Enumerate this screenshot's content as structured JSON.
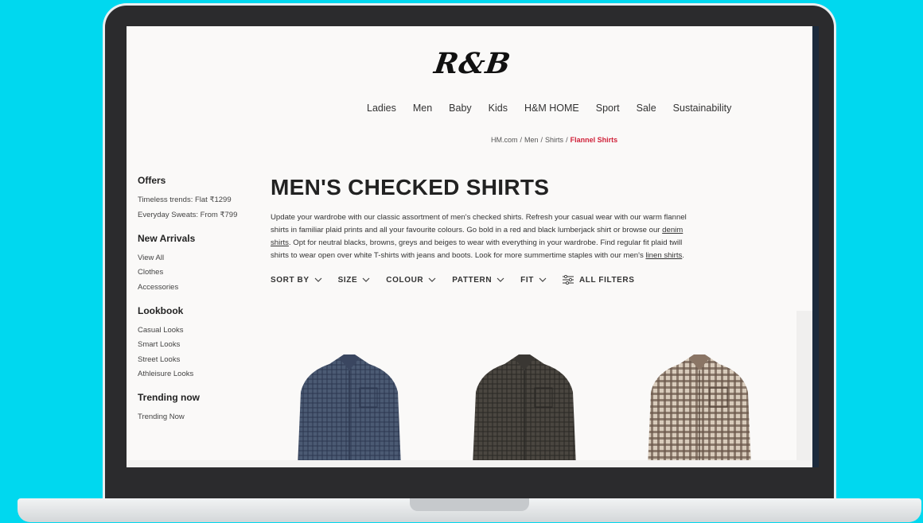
{
  "brand": {
    "logo": "R&B"
  },
  "nav": [
    "Ladies",
    "Men",
    "Baby",
    "Kids",
    "H&M HOME",
    "Sport",
    "Sale",
    "Sustainability"
  ],
  "breadcrumb": {
    "items": [
      "HM.com",
      "Men",
      "Shirts"
    ],
    "current": "Flannel Shirts"
  },
  "sidebar": {
    "offers": {
      "title": "Offers",
      "items": [
        "Timeless trends: Flat ₹1299",
        "Everyday Sweats: From ₹799"
      ]
    },
    "new_arrivals": {
      "title": "New Arrivals",
      "items": [
        "View All",
        "Clothes",
        "Accessories"
      ]
    },
    "lookbook": {
      "title": "Lookbook",
      "items": [
        "Casual Looks",
        "Smart Looks",
        "Street Looks",
        "Athleisure Looks"
      ]
    },
    "trending": {
      "title": "Trending now",
      "items": [
        "Trending Now"
      ]
    }
  },
  "main": {
    "title": "MEN'S CHECKED SHIRTS",
    "desc_1": "Update your wardrobe with our classic assortment of men's checked shirts. Refresh your casual wear with our warm flannel shirts in familiar plaid prints and all your favourite colours. Go bold in a red and black lumberjack shirt or browse our ",
    "desc_link_1": "denim shirts",
    "desc_2": ". Opt for neutral blacks, browns, greys and beiges to wear with everything in your wardrobe. Find regular fit plaid twill shirts to wear open over white T-shirts with jeans and boots. Look for more summertime staples with our men's ",
    "desc_link_2": "linen shirts",
    "desc_3": "."
  },
  "filters": [
    "SORT BY",
    "SIZE",
    "COLOUR",
    "PATTERN",
    "FIT"
  ],
  "all_filters": "ALL FILTERS",
  "products": [
    {
      "name": "navy-check-shirt",
      "color": "#4b5a73",
      "line": "#2d3850"
    },
    {
      "name": "dark-brown-check-shirt",
      "color": "#4a4640",
      "line": "#2a2825"
    },
    {
      "name": "beige-check-shirt",
      "color": "#cdbfae",
      "line": "#4a3a30"
    }
  ]
}
